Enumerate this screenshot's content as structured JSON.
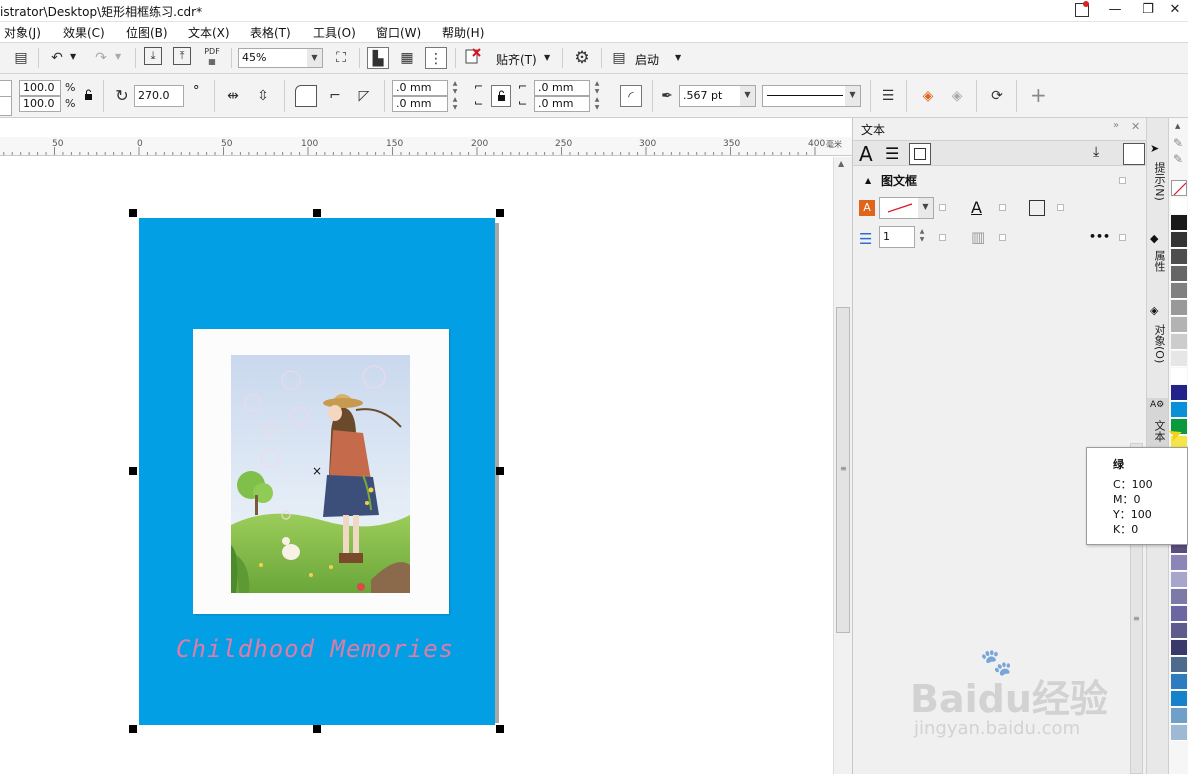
{
  "titlebar": {
    "title": "istrator\\Desktop\\矩形相框练习.cdr*",
    "minimize": "—",
    "restore": "❐",
    "close": "✕"
  },
  "menu": [
    "对象(J)",
    "效果(C)",
    "位图(B)",
    "文本(X)",
    "表格(T)",
    "工具(O)",
    "窗口(W)",
    "帮助(H)"
  ],
  "toolbar1": {
    "zoom": "45%",
    "snap_label": "贴齐(T)",
    "launch_label": "启动"
  },
  "toolbar2": {
    "scale_x": "100.0",
    "scale_y": "100.0",
    "percent": "%",
    "rotation": "270.0",
    "degree": "°",
    "corner_tl": ".0 mm",
    "corner_bl": ".0 mm",
    "corner_tr": ".0 mm",
    "corner_br": ".0 mm",
    "outline_width": ".567 pt",
    "plus": "+"
  },
  "ruler": {
    "labels": [
      "50",
      "0",
      "50",
      "100",
      "150",
      "200",
      "250",
      "300",
      "350",
      "400"
    ],
    "unit": "毫米"
  },
  "artwork": {
    "caption": "Childhood Memories",
    "background_color": "#039fe4",
    "caption_color": "#e07aa6"
  },
  "docker": {
    "title": "文本",
    "section_title": "图文框",
    "columns_value": "1",
    "more": "•••"
  },
  "side_tabs": [
    "提示(N)",
    "属性",
    "对象(O)",
    "文本"
  ],
  "tooltip": {
    "name": "绿",
    "c": "C：100",
    "m": "M：0",
    "y": "Y：100",
    "k": "K：0"
  },
  "watermark": {
    "brand": "Baidu经验",
    "url": "jingyan.baidu.com"
  },
  "palette_colors": [
    "#ffffff",
    "#1a1a1a",
    "#333333",
    "#4d4d4d",
    "#666666",
    "#808080",
    "#999999",
    "#b3b3b3",
    "#cccccc",
    "#e6e6e6",
    "#ffffff",
    "#22228a",
    "#0b8fd6",
    "#0a9a3e",
    "#f4e64a",
    "#d7a22c",
    "#b3282d",
    "#6f2a2a",
    "#7a4b3a",
    "#8c6d5a",
    "#5a4e7d",
    "#8c86b8",
    "#a8a5cc",
    "#7e7aa8",
    "#6c67a0",
    "#5d5a8e",
    "#3a3a6a",
    "#4e6b8e",
    "#2e7bbf",
    "#1682cc",
    "#6fa1c8",
    "#9db9d4"
  ]
}
